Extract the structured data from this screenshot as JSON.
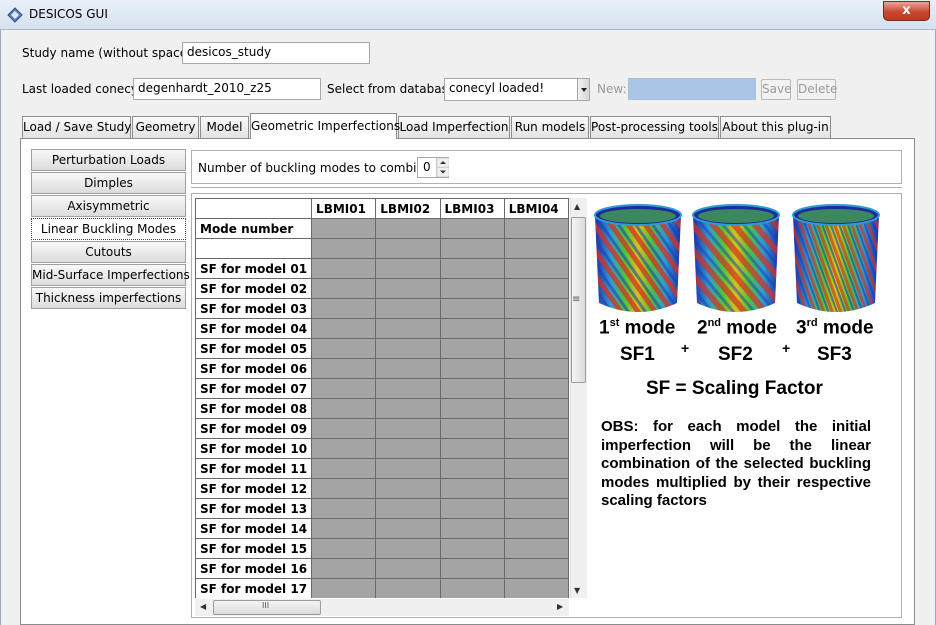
{
  "window": {
    "title": "DESICOS GUI",
    "close_glyph": "x"
  },
  "study": {
    "label": "Study name (without spaces):",
    "value": "desicos_study"
  },
  "conecyl": {
    "last_label": "Last loaded conecyl:",
    "last_value": "degenhardt_2010_z25",
    "db_label": "Select from database:",
    "db_value": "conecyl loaded!",
    "new_label": "New:",
    "new_value": "",
    "save_label": "Save",
    "delete_label": "Delete"
  },
  "tabs": [
    {
      "label": "Load / Save Study"
    },
    {
      "label": "Geometry"
    },
    {
      "label": "Model"
    },
    {
      "label": "Geometric Imperfections",
      "active": true
    },
    {
      "label": "Load Imperfection"
    },
    {
      "label": "Run models"
    },
    {
      "label": "Post-processing tools"
    },
    {
      "label": "About this plug-in"
    }
  ],
  "nav": [
    {
      "label": "Perturbation Loads"
    },
    {
      "label": "Dimples"
    },
    {
      "label": "Axisymmetric"
    },
    {
      "label": "Linear Buckling Modes",
      "active": true
    },
    {
      "label": "Cutouts"
    },
    {
      "label": "Mid-Surface Imperfections"
    },
    {
      "label": "Thickness imperfections"
    }
  ],
  "modes": {
    "label": "Number of buckling modes to combine:",
    "value": "0"
  },
  "table": {
    "columns": [
      "LBMI01",
      "LBMI02",
      "LBMI03",
      "LBMI04"
    ],
    "mode_row": "Mode number",
    "blank_row": "",
    "rows": [
      "SF for model 01",
      "SF for model 02",
      "SF for model 03",
      "SF for model 04",
      "SF for model 05",
      "SF for model 06",
      "SF for model 07",
      "SF for model 08",
      "SF for model 09",
      "SF for model 10",
      "SF for model 11",
      "SF for model 12",
      "SF for model 13",
      "SF for model 14",
      "SF for model 15",
      "SF for model 16",
      "SF for model 17"
    ],
    "scroll_mid_glyph": "III",
    "vscroll_mid_glyph": "≡"
  },
  "figure": {
    "mode1_num": "1",
    "mode1_sup": "st",
    "mode_word": " mode",
    "mode2_num": "2",
    "mode2_sup": "nd",
    "mode3_num": "3",
    "mode3_sup": "rd",
    "sf1": "SF1",
    "sf2": "SF2",
    "sf3": "SF3",
    "plus": "+",
    "sf_caption": "SF = Scaling Factor",
    "obs": "OBS: for each model the initial imperfection will be the linear combination of the selected buckling modes multiplied by their respective scaling factors"
  }
}
